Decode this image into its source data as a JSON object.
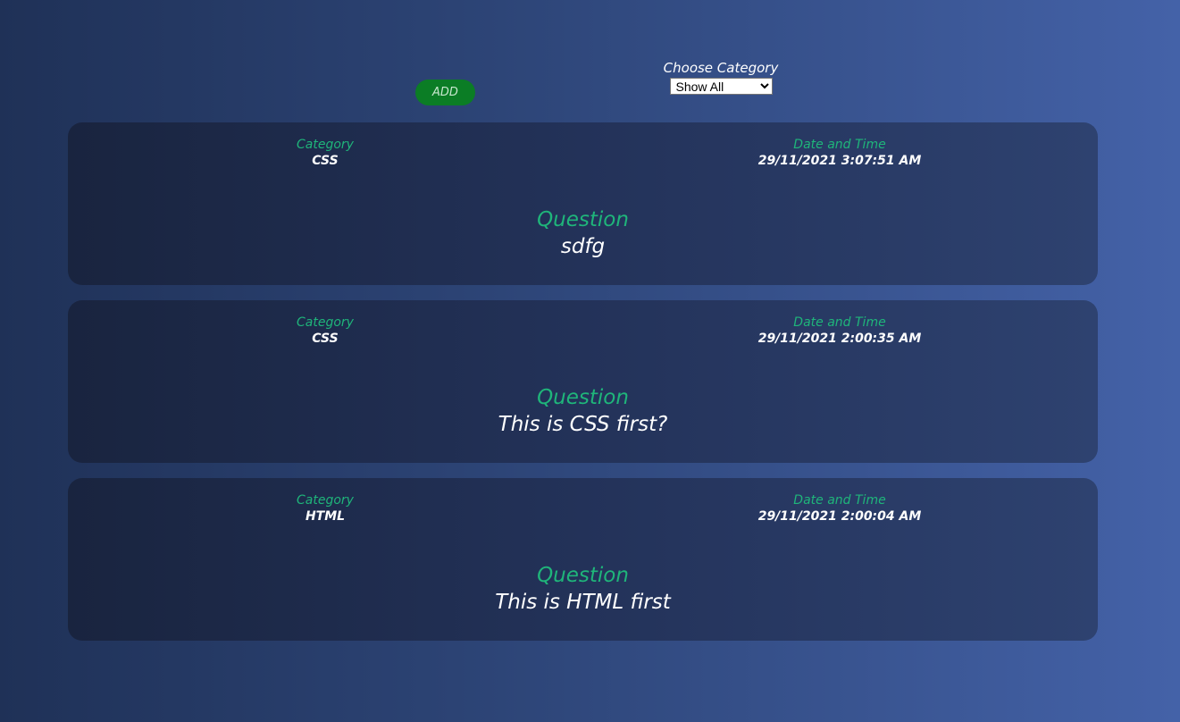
{
  "toolbar": {
    "add_label": "ADD",
    "filter_label": "Choose Category",
    "filter_selected": "Show All"
  },
  "labels": {
    "category": "Category",
    "date_time": "Date and Time",
    "question": "Question"
  },
  "questions": [
    {
      "category": "CSS",
      "datetime": "29/11/2021 3:07:51 AM",
      "text": "sdfg"
    },
    {
      "category": "CSS",
      "datetime": "29/11/2021 2:00:35 AM",
      "text": "This is CSS first?"
    },
    {
      "category": "HTML",
      "datetime": "29/11/2021 2:00:04 AM",
      "text": "This is HTML first"
    }
  ],
  "colors": {
    "accent": "#1fb57a",
    "add_button": "#0b7d25"
  }
}
